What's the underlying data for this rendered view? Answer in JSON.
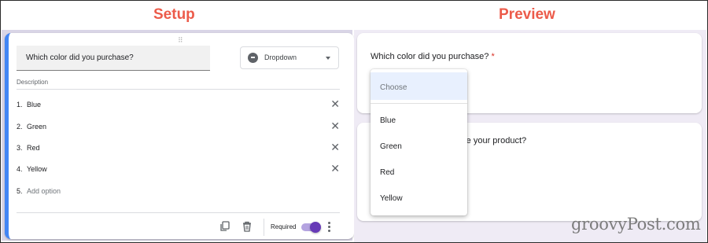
{
  "headings": {
    "setup": "Setup",
    "preview": "Preview"
  },
  "setup": {
    "question": "Which color did you purchase?",
    "type_select": {
      "icon": "dropdown-type-icon",
      "label": "Dropdown"
    },
    "description_label": "Description",
    "options": [
      {
        "num": "1.",
        "label": "Blue"
      },
      {
        "num": "2.",
        "label": "Green"
      },
      {
        "num": "3.",
        "label": "Red"
      },
      {
        "num": "4.",
        "label": "Yellow"
      }
    ],
    "add_option": {
      "num": "5.",
      "label": "Add option"
    },
    "required_label": "Required",
    "required_on": true,
    "colors": {
      "accent": "#4285f4",
      "toggle": "#673ab7",
      "heading": "#ec5b4a"
    }
  },
  "preview": {
    "question": "Which color did you purchase?",
    "required_mark": "*",
    "second_question_partial": "eceive your product?",
    "dropdown": {
      "placeholder": "Choose",
      "items": [
        "Blue",
        "Green",
        "Red",
        "Yellow"
      ]
    }
  },
  "watermark": "groovyPost.com"
}
